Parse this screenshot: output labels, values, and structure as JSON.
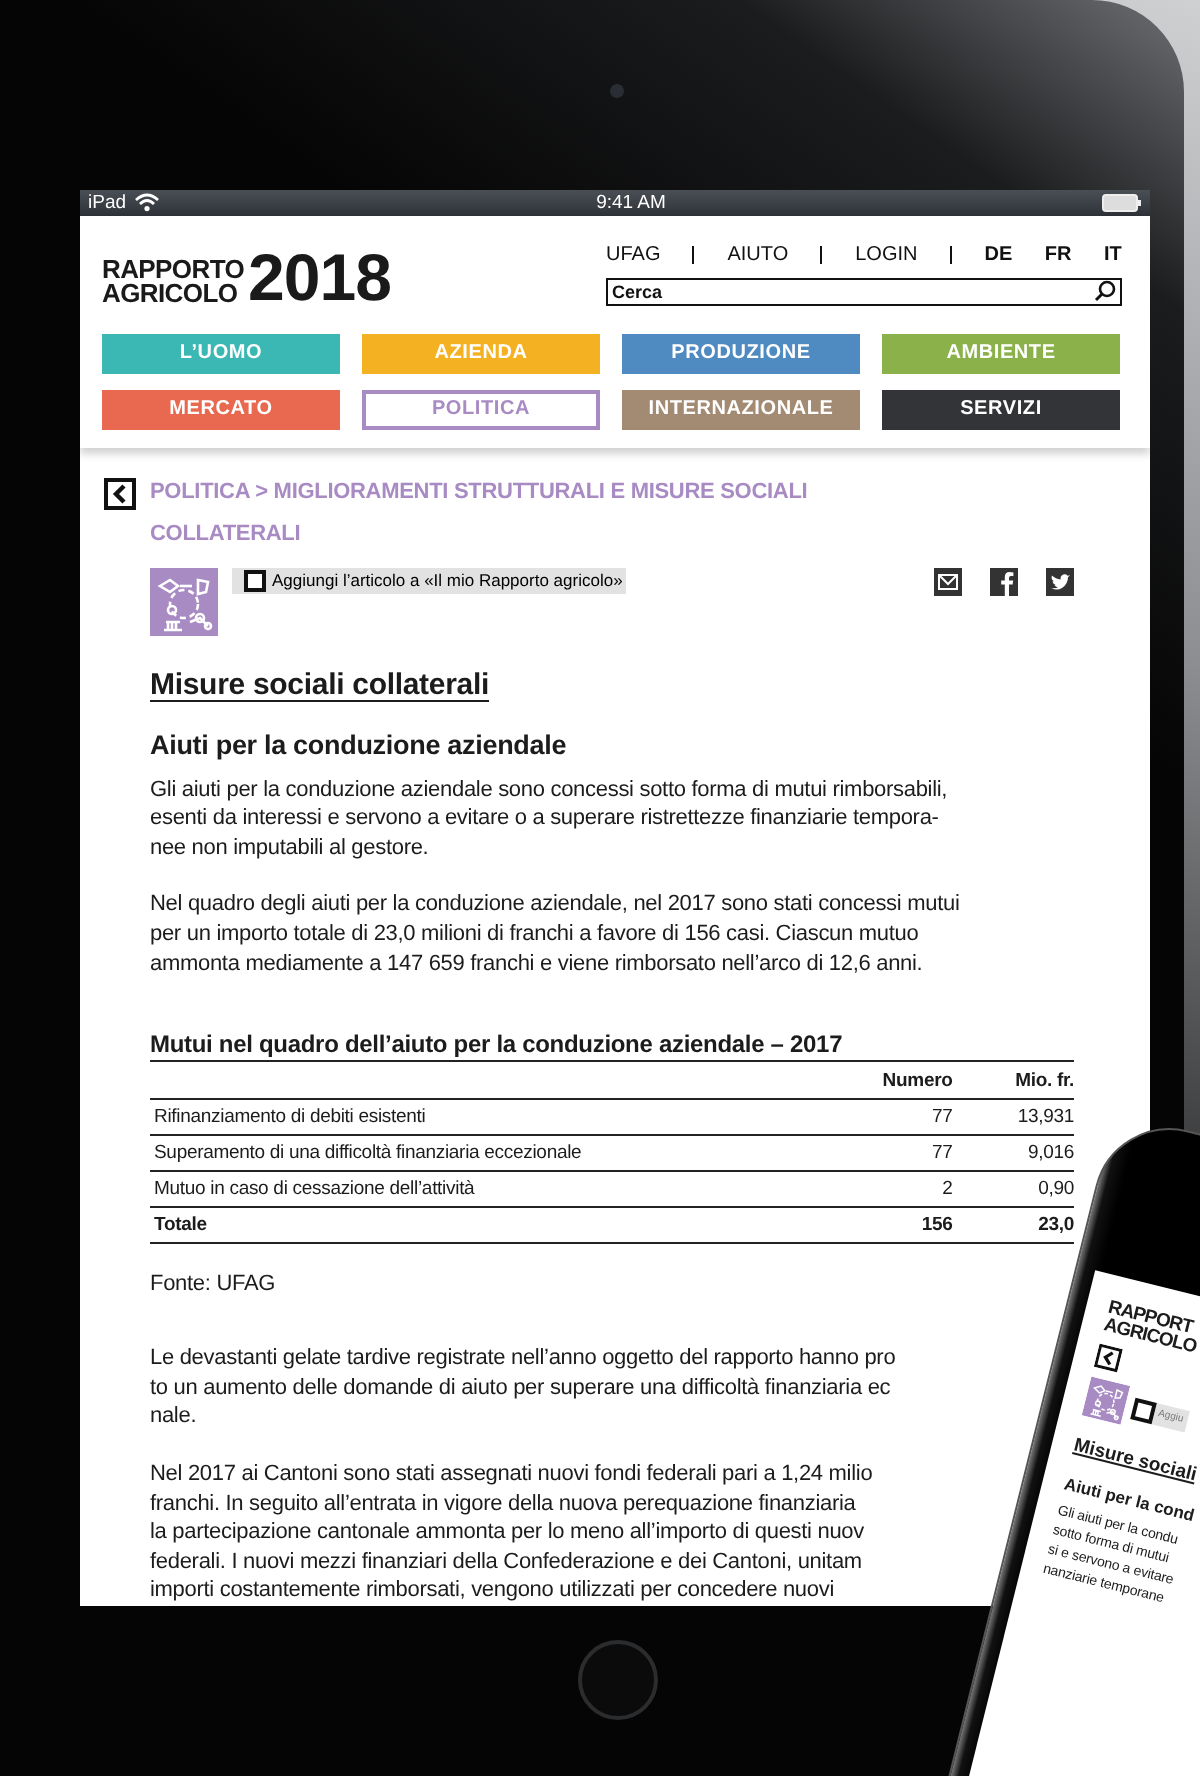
{
  "status_bar": {
    "device": "iPad",
    "time": "9:41 AM"
  },
  "header": {
    "logo_lines": [
      "RAPPORTO",
      "AGRICOLO"
    ],
    "logo_year": "2018",
    "links": [
      "UFAG",
      "AIUTO",
      "LOGIN"
    ],
    "languages": [
      "DE",
      "FR",
      "IT"
    ],
    "search": {
      "placeholder": "Cerca"
    }
  },
  "categories": [
    {
      "label": "L’UOMO",
      "color": "#3cb8b4",
      "selected": false
    },
    {
      "label": "AZIENDA",
      "color": "#f4b223",
      "selected": false
    },
    {
      "label": "PRODUZIONE",
      "color": "#4f8ac1",
      "selected": false
    },
    {
      "label": "AMBIENTE",
      "color": "#8bb14a",
      "selected": false
    },
    {
      "label": "MERCATO",
      "color": "#e8694f",
      "selected": false
    },
    {
      "label": "POLITICA",
      "color": "#a98bc4",
      "selected": true
    },
    {
      "label": "INTERNAZIONALE",
      "color": "#a38a72",
      "selected": false
    },
    {
      "label": "SERVIZI",
      "color": "#333438",
      "selected": false
    }
  ],
  "article": {
    "breadcrumb_lines": [
      "POLITICA > MIGLIORAMENTI STRUTTURALI E MISURE SOCIALI",
      "COLLATERALI"
    ],
    "bookmark": {
      "label": "Aggiungi l’articolo a «Il mio Rapporto agricolo»",
      "checked": false
    },
    "title": "Misure sociali collaterali",
    "subtitle": "Aiuti per la conduzione aziendale",
    "paragraphs_before": [
      [
        "Gli aiuti per la conduzione aziendale sono concessi sotto forma di mutui rimborsabili,",
        "esenti da interessi e servono a evitare o a superare ristrettezze finanziarie tempora-",
        "nee non imputabili al gestore."
      ],
      [
        "Nel quadro degli aiuti per la conduzione aziendale, nel 2017 sono stati concessi mutui",
        "per un importo totale di 23,0 milioni di franchi a favore di 156 casi. Ciascun mutuo",
        "ammonta mediamente a 147 659 franchi e viene rimborsato nell’arco di 12,6 anni."
      ]
    ],
    "table": {
      "title": "Mutui nel quadro dell’aiuto per la conduzione aziendale – 2017",
      "columns": [
        "Numero",
        "Mio. fr."
      ],
      "rows": [
        {
          "kind": "item",
          "label": "Rifinanziamento di debiti esistenti",
          "cells": [
            "77",
            "13,931"
          ]
        },
        {
          "kind": "item",
          "label": "Superamento di una difficoltà finanziaria eccezionale",
          "cells": [
            "77",
            "9,016"
          ]
        },
        {
          "kind": "item",
          "label": "Mutuo in caso di cessazione dell’attività",
          "cells": [
            "2",
            "0,90"
          ]
        },
        {
          "kind": "total",
          "label": "Totale",
          "cells": [
            "156",
            "23,0"
          ]
        }
      ]
    },
    "source": "Fonte: UFAG",
    "paragraphs_after": [
      [
        "Le devastanti gelate tardive registrate nell’anno oggetto del rapporto hanno pro",
        "to un aumento delle domande di aiuto per superare una difficoltà finanziaria ec",
        "nale."
      ],
      [
        "Nel 2017 ai Cantoni sono stati assegnati nuovi fondi federali pari a 1,24 milio",
        "franchi. In seguito all’entrata in vigore della nuova perequazione finanziaria",
        "la partecipazione cantonale ammonta per lo meno all’importo di questi nuov",
        "federali. I nuovi mezzi finanziari della Confederazione e dei Cantoni, unitam",
        "importi costantemente rimborsati, vengono utilizzati per concedere nuovi"
      ]
    ]
  },
  "phone": {
    "logo_lines": [
      "RAPPORT",
      "AGRICOLO"
    ],
    "bookmark": {
      "label": "Aggiu",
      "checked": false
    },
    "title": "Misure sociali",
    "subtitle": "Aiuti per la cond",
    "lines": [
      "Gli aiuti per la condu",
      "sotto forma di mutui",
      "si e servono a evitare",
      "nanziarie temporane"
    ]
  }
}
